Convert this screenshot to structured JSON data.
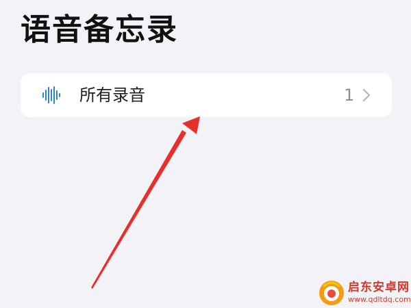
{
  "header": {
    "title": "语音备忘录"
  },
  "list": {
    "items": [
      {
        "icon": "waveform-icon",
        "label": "所有录音",
        "count": "1",
        "trailing_icon": "chevron-right-icon"
      }
    ]
  },
  "colors": {
    "background": "#f2f2f7",
    "card": "#ffffff",
    "accent_blue": "#2e86c1",
    "arrow_red": "#e8302a",
    "watermark_red": "#d0392b"
  },
  "watermark": {
    "title": "启东安卓网",
    "url": "www.qdltdq.com"
  }
}
